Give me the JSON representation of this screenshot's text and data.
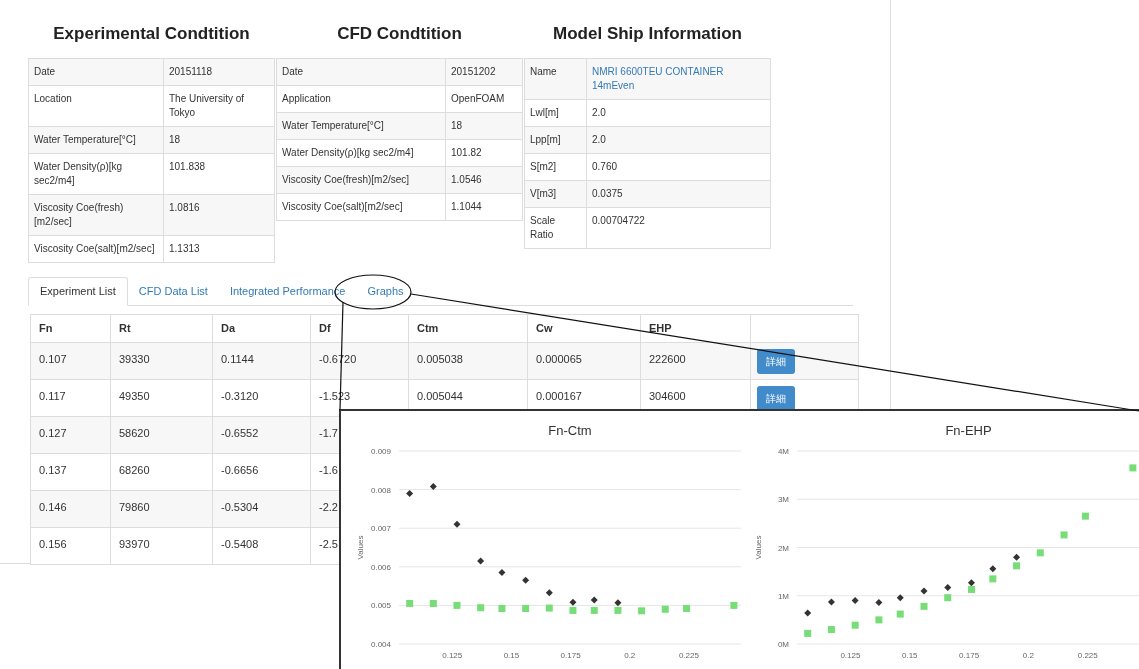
{
  "sections": [
    {
      "title": "Experimental Condtition",
      "rows": [
        {
          "label": "Date",
          "value": "20151118",
          "kind": "text"
        },
        {
          "label": "Location",
          "value": "The University of Tokyo",
          "kind": "text"
        },
        {
          "label": "Water Temperature[°C]",
          "value": "18",
          "kind": "text"
        },
        {
          "label": "Water Density(ρ)[kg sec2/m4]",
          "value": "101.838",
          "kind": "text"
        },
        {
          "label": "Viscosity Coe(fresh)[m2/sec]",
          "value": "1.0816",
          "kind": "text"
        },
        {
          "label": "Viscosity Coe(salt)[m2/sec]",
          "value": "1.1313",
          "kind": "text"
        }
      ]
    },
    {
      "title": "CFD Condtition",
      "rows": [
        {
          "label": "Date",
          "value": "20151202",
          "kind": "text"
        },
        {
          "label": "Application",
          "value": "OpenFOAM",
          "kind": "text"
        },
        {
          "label": "Water Temperature[°C]",
          "value": "18",
          "kind": "text"
        },
        {
          "label": "Water Density(ρ)[kg sec2/m4]",
          "value": "101.82",
          "kind": "text"
        },
        {
          "label": "Viscosity Coe(fresh)[m2/sec]",
          "value": "1.0546",
          "kind": "text"
        },
        {
          "label": "Viscosity Coe(salt)[m2/sec]",
          "value": "1.1044",
          "kind": "text"
        }
      ]
    },
    {
      "title": "Model Ship Information",
      "rows": [
        {
          "label": "Name",
          "value": "NMRI 6600TEU CONTAINER 14mEven",
          "kind": "link"
        },
        {
          "label": "Lwl[m]",
          "value": "2.0",
          "kind": "text"
        },
        {
          "label": "Lpp[m]",
          "value": "2.0",
          "kind": "text"
        },
        {
          "label": "S[m2]",
          "value": "0.760",
          "kind": "text"
        },
        {
          "label": "V[m3]",
          "value": "0.0375",
          "kind": "text"
        },
        {
          "label": "Scale Ratio",
          "value": "0.00704722",
          "kind": "text"
        }
      ]
    }
  ],
  "tabs": [
    {
      "label": "Experiment List",
      "selected": true
    },
    {
      "label": "CFD Data List",
      "selected": false
    },
    {
      "label": "Integrated Performance",
      "selected": false
    },
    {
      "label": "Graphs",
      "selected": false
    }
  ],
  "experiment_table": {
    "columns": [
      "Fn",
      "Rt",
      "Da",
      "Df",
      "Ctm",
      "Cw",
      "EHP"
    ],
    "rows": [
      {
        "cells": [
          "0.107",
          "39330",
          "0.1144",
          "-0.6720",
          "0.005038",
          "0.000065",
          "222600"
        ],
        "button": "詳細"
      },
      {
        "cells": [
          "0.117",
          "49350",
          "-0.3120",
          "-1.523",
          "0.005044",
          "0.000167",
          "304600"
        ],
        "button": "詳細"
      },
      {
        "cells": [
          "0.127",
          "58620",
          "-0.6552",
          "-1.7"
        ]
      },
      {
        "cells": [
          "0.137",
          "68260",
          "-0.6656",
          "-1.6"
        ]
      },
      {
        "cells": [
          "0.146",
          "79860",
          "-0.5304",
          "-2.2"
        ]
      },
      {
        "cells": [
          "0.156",
          "93970",
          "-0.5408",
          "-2.5"
        ]
      }
    ]
  },
  "graphs": [
    {
      "chart_data": {
        "type": "scatter",
        "grid": true,
        "title": "Fn-Ctm",
        "ylabel": "Values",
        "x": [
          0.107,
          0.117,
          0.127,
          0.137,
          0.146,
          0.156,
          0.166,
          0.176,
          0.185,
          0.195,
          0.205,
          0.215,
          0.224,
          0.244
        ],
        "xlim": [
          0.1025,
          0.247
        ],
        "ylim": [
          0.004,
          0.009
        ],
        "xticks": [
          0.125,
          0.15,
          0.175,
          0.2,
          0.225
        ],
        "yticks": [
          0.004,
          0.005,
          0.006,
          0.007,
          0.008,
          0.009
        ],
        "series": [
          {
            "color": "#333333",
            "marker": "diamond",
            "values": [
              0.0079,
              0.00808,
              0.0071,
              0.00615,
              0.00585,
              0.00565,
              0.00533,
              0.00508,
              0.00514,
              0.00507,
              null,
              null,
              null,
              null
            ]
          },
          {
            "color": "#77dd77",
            "marker": "square",
            "values": [
              0.00505,
              0.00505,
              0.005,
              0.00494,
              0.00492,
              0.00492,
              0.00493,
              0.00487,
              0.00487,
              0.00487,
              0.00486,
              0.0049,
              0.00492,
              0.005
            ]
          }
        ]
      }
    },
    {
      "chart_data": {
        "type": "scatter",
        "grid": true,
        "title": "Fn-EHP",
        "ylabel": "Values",
        "x": [
          0.107,
          0.117,
          0.127,
          0.137,
          0.146,
          0.156,
          0.166,
          0.176,
          0.185,
          0.195,
          0.205,
          0.215,
          0.224,
          0.244
        ],
        "xlim": [
          0.1025,
          0.247
        ],
        "ylim": [
          0,
          4000000
        ],
        "xticks": [
          0.125,
          0.15,
          0.175,
          0.2,
          0.225
        ],
        "yticks": [
          {
            "value": 0,
            "label": "0M"
          },
          {
            "value": 1000000,
            "label": "1M"
          },
          {
            "value": 2000000,
            "label": "2M"
          },
          {
            "value": 3000000,
            "label": "3M"
          },
          {
            "value": 4000000,
            "label": "4M"
          }
        ],
        "series": [
          {
            "color": "#333333",
            "marker": "diamond",
            "values": [
              640000,
              870000,
              900000,
              860000,
              960000,
              1100000,
              1170000,
              1270000,
              1560000,
              1800000,
              null,
              null,
              null,
              null
            ]
          },
          {
            "color": "#77dd77",
            "marker": "square",
            "values": [
              220000,
              300000,
              390000,
              500000,
              620000,
              780000,
              960000,
              1130000,
              1350000,
              1620000,
              1890000,
              2260000,
              2650000,
              3650000
            ]
          }
        ]
      }
    }
  ]
}
